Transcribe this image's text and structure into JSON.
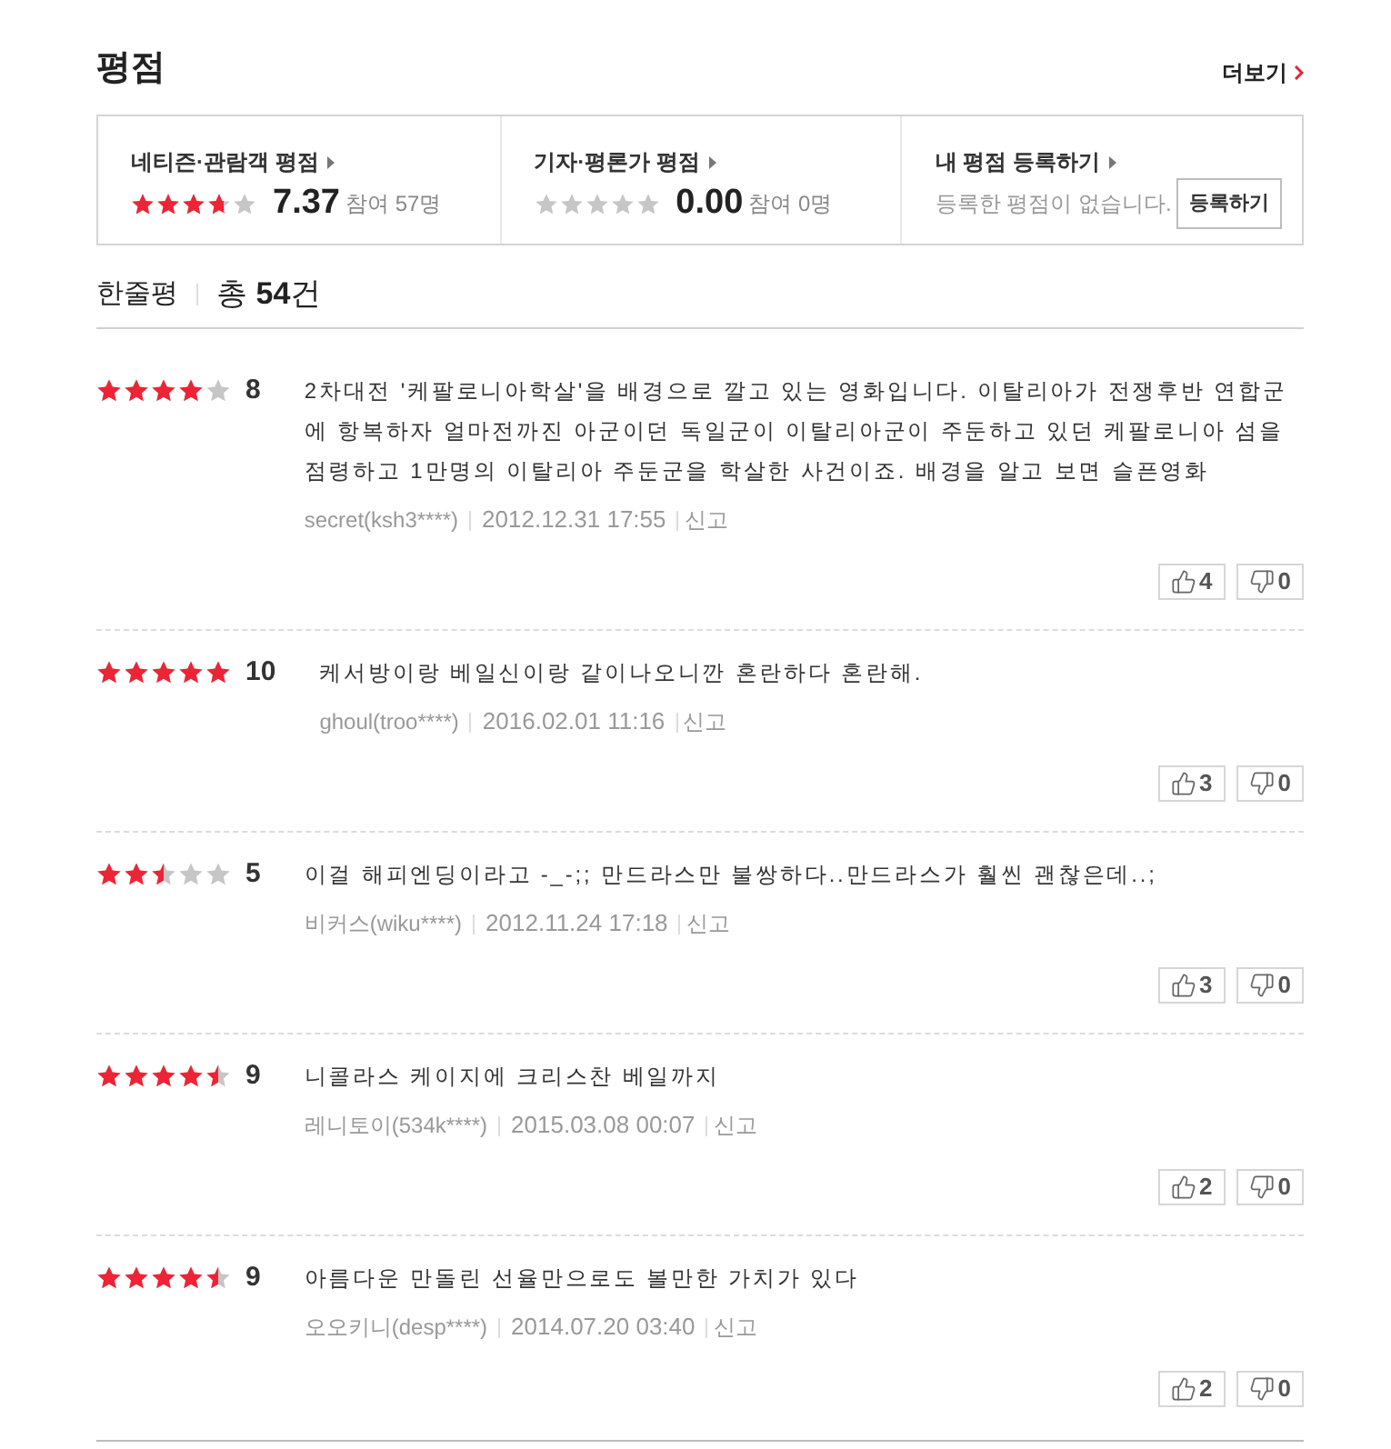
{
  "section": {
    "title": "평점",
    "more_link": "더보기"
  },
  "summary": [
    {
      "kind": "rating",
      "label": "네티즌·관람객 평점",
      "stars": 3.7,
      "score": "7.37",
      "participants": "참여 57명"
    },
    {
      "kind": "rating",
      "label": "기자·평론가 평점",
      "stars": 0,
      "score": "0.00",
      "participants": "참여 0명"
    },
    {
      "kind": "register",
      "label": "내 평점 등록하기",
      "message": "등록한 평점이 없습니다.",
      "button": "등록하기"
    }
  ],
  "reviews_header": {
    "title": "한줄평",
    "total": "총 **54**건"
  },
  "reviews": [
    {
      "stars": 4,
      "score": "8",
      "text": "2차대전 '케팔로니아학살'을 배경으로 깔고 있는 영화입니다. 이탈리아가 전쟁후반 연합군에 항복하자 얼마전까진 아군이던 독일군이 이탈리아군이 주둔하고 있던 케팔로니아 섬을 점령하고 1만명의 이탈리아 주둔군을 학살한 사건이죠. 배경을 알고 보면 슬픈영화",
      "author": "secret(ksh3****)",
      "date": "2012.12.31 17:55",
      "report": "신고",
      "likes": "4",
      "dislikes": "0"
    },
    {
      "stars": 5,
      "score": "10",
      "text": "케서방이랑 베일신이랑 같이나오니깐 혼란하다 혼란해.",
      "author": "ghoul(troo****)",
      "date": "2016.02.01 11:16",
      "report": "신고",
      "likes": "3",
      "dislikes": "0"
    },
    {
      "stars": 2.5,
      "score": "5",
      "text": "이걸 해피엔딩이라고 -_-;; 만드라스만 불쌍하다..만드라스가 훨씬 괜찮은데..;",
      "author": "비커스(wiku****)",
      "date": "2012.11.24 17:18",
      "report": "신고",
      "likes": "3",
      "dislikes": "0"
    },
    {
      "stars": 4.5,
      "score": "9",
      "text": "니콜라스 케이지에 크리스찬 베일까지",
      "author": "레니토이(534k****)",
      "date": "2015.03.08 00:07",
      "report": "신고",
      "likes": "2",
      "dislikes": "0"
    },
    {
      "stars": 4.5,
      "score": "9",
      "text": "아름다운 만돌린 선율만으로도 볼만한 가치가 있다",
      "author": "오오키니(desp****)",
      "date": "2014.07.20 03:40",
      "report": "신고",
      "likes": "2",
      "dislikes": "0"
    }
  ]
}
